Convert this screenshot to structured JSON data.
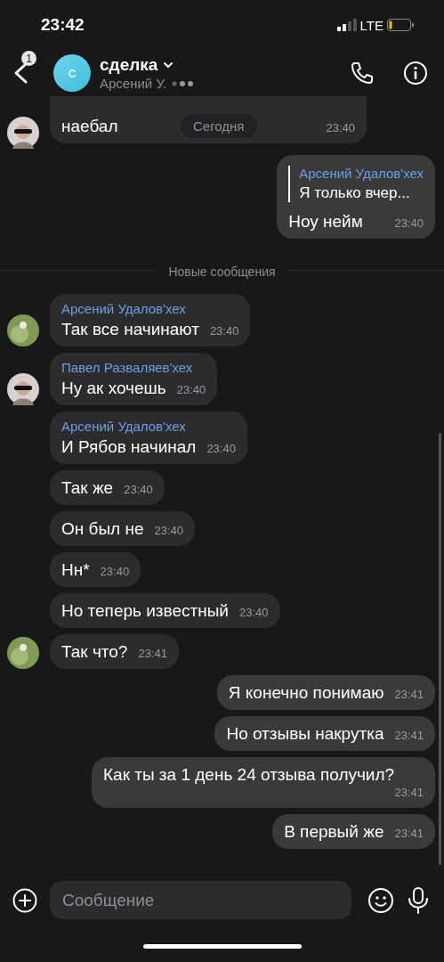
{
  "status_bar": {
    "time": "23:42",
    "network": "LTE"
  },
  "header": {
    "unread": "1",
    "avatar_letter": "с",
    "title": "сделка",
    "subtitle": "Арсений У.",
    "typing": true
  },
  "date_pill": "Сегодня",
  "messages": [
    {
      "kind": "incoming",
      "clipped": true,
      "avatar": {
        "kind": "glasses"
      },
      "text": "наебал",
      "time": "23:40"
    },
    {
      "kind": "outgoing",
      "quote": {
        "author": "Арсений Удалов'хех",
        "text": "Я только вчер..."
      },
      "text": "Ноу нейм",
      "time": "23:40"
    },
    {
      "kind": "divider",
      "text": "Новые сообщения"
    },
    {
      "kind": "incoming",
      "sender": "Арсений Удалов'хех",
      "avatar": {
        "kind": "flower"
      },
      "text": "Так все начинают",
      "time": "23:40"
    },
    {
      "kind": "incoming",
      "sender": "Павел Разваляев'хех",
      "avatar": {
        "kind": "glasses"
      },
      "text": "Ну ак хочешь",
      "time": "23:40"
    },
    {
      "kind": "incoming",
      "sender": "Арсений Удалов'хех",
      "text": "И Рябов начинал",
      "time": "23:40"
    },
    {
      "kind": "incoming",
      "text": "Так же",
      "time": "23:40"
    },
    {
      "kind": "incoming",
      "text": "Он был не",
      "time": "23:40"
    },
    {
      "kind": "incoming",
      "text": "Нн*",
      "time": "23:40"
    },
    {
      "kind": "incoming",
      "text": "Но теперь известный",
      "time": "23:40"
    },
    {
      "kind": "incoming",
      "avatar": {
        "kind": "flower"
      },
      "text": "Так что?",
      "time": "23:41"
    },
    {
      "kind": "outgoing",
      "text": "Я конечно понимаю",
      "time": "23:41"
    },
    {
      "kind": "outgoing",
      "text": "Но отзывы накрутка",
      "time": "23:41"
    },
    {
      "kind": "outgoing",
      "text": "Как ты за 1 день 24 отзыва получил?",
      "time": "23:41"
    },
    {
      "kind": "outgoing",
      "text": "В первый же",
      "time": "23:41"
    }
  ],
  "composer": {
    "placeholder": "Сообщение"
  }
}
